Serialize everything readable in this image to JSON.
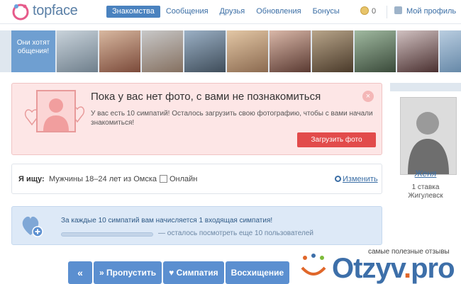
{
  "header": {
    "logo_text": "topface",
    "nav": [
      {
        "label": "Знакомства",
        "active": true
      },
      {
        "label": "Сообщения",
        "active": false
      },
      {
        "label": "Друзья",
        "active": false
      },
      {
        "label": "Обновления",
        "active": false
      },
      {
        "label": "Бонусы",
        "active": false
      }
    ],
    "coins": "0",
    "profile_label": "Мой профиль"
  },
  "strip": {
    "label": "Они хотят общения!"
  },
  "promo": {
    "title": "Пока у вас нет фото, с вами не познакомиться",
    "text": "У вас есть 10 симпатий! Осталось загрузить свою фотографию, чтобы с вами начали знакомиться!",
    "button": "Загрузить фото",
    "close": "×"
  },
  "filter": {
    "label": "Я ищу:",
    "value": "Мужчины 18–24 лет из Омска",
    "online_label": "Онлайн",
    "online_checked": false,
    "change_label": "Изменить"
  },
  "sympathy": {
    "text": "За каждые 10 симпатий вам начисляется 1 входящая симпатия!",
    "progress": 0,
    "progress_text": "— осталось посмотреть еще 10 пользователей"
  },
  "actions": {
    "back": "«",
    "skip": "»  Пропустить",
    "like": "♥ Симпатия",
    "admire": "Восхищение"
  },
  "right_panel": {
    "name": "Женя",
    "bid": "1 ставка",
    "city": "Жигулевск"
  },
  "watermark": {
    "tagline": "самые полезные отзывы",
    "brand_main": "Otzyv",
    "brand_dot": ".",
    "brand_tld": "pro"
  },
  "colors": {
    "accent": "#4a82bf",
    "promo_bg": "#fde6e6",
    "promo_btn": "#e24b4b",
    "sympathy_bg": "#dde9f7"
  }
}
